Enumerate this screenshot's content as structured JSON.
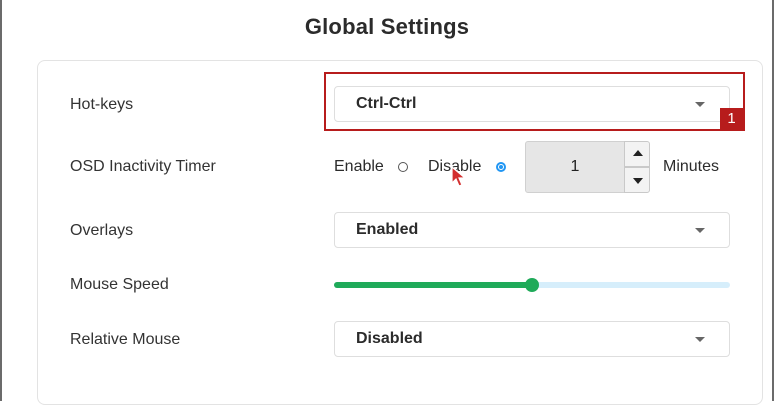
{
  "title": "Global Settings",
  "rows": {
    "hotkeys": {
      "label": "Hot-keys",
      "value": "Ctrl-Ctrl"
    },
    "osd": {
      "label": "OSD Inactivity Timer",
      "enable_label": "Enable",
      "disable_label": "Disable",
      "selected": "Disable",
      "timer_value": "1",
      "unit": "Minutes"
    },
    "overlays": {
      "label": "Overlays",
      "value": "Enabled"
    },
    "mouse_speed": {
      "label": "Mouse Speed",
      "level_fraction": 0.5
    },
    "relative_mouse": {
      "label": "Relative Mouse",
      "value": "Disabled"
    }
  },
  "annotation": {
    "badge": "1"
  },
  "icons": {
    "dropdown": "chevron-down-icon",
    "stepper_up": "arrow-up-icon",
    "stepper_down": "arrow-down-icon",
    "cursor": "mouse-pointer-icon"
  },
  "colors": {
    "highlight": "#b71c1c",
    "slider_fill": "#1faa59",
    "slider_track": "#d6eefb",
    "radio_selected": "#2196f3"
  }
}
